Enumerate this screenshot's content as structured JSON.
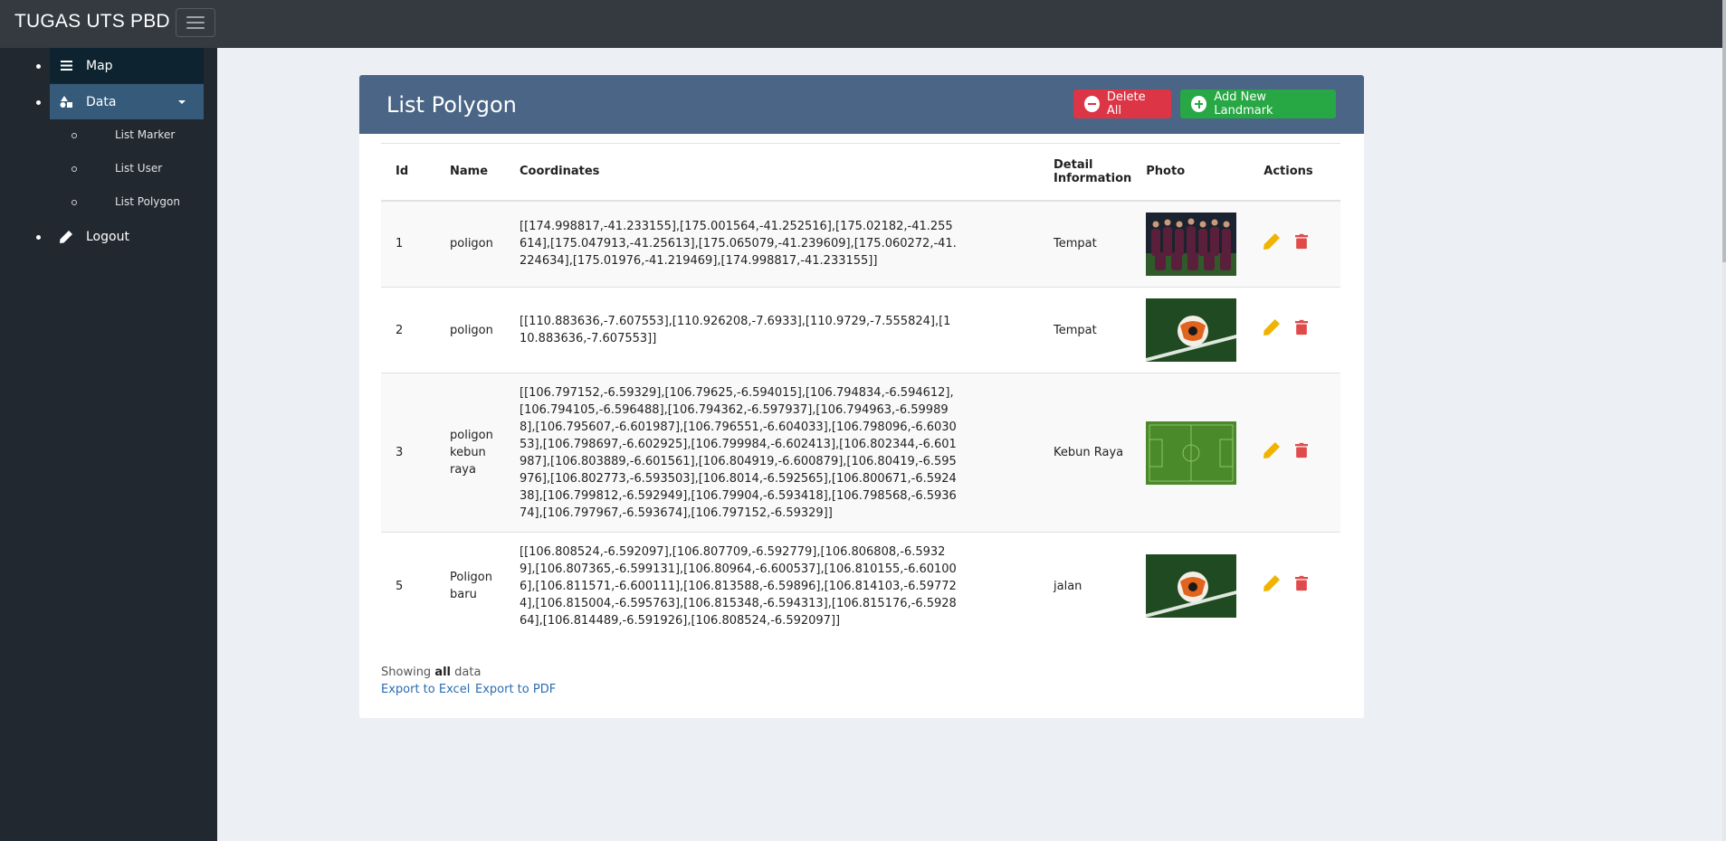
{
  "app": {
    "title": "TUGAS UTS PBD",
    "menu_toggle_icon": "hamburger-icon"
  },
  "sidebar": {
    "items": [
      {
        "label": "Map",
        "icon": "list-icon"
      },
      {
        "label": "Data",
        "icon": "shapes-icon"
      },
      {
        "label": "Logout",
        "icon": "pencil-icon"
      }
    ],
    "sub_items": [
      "List Marker",
      "List User",
      "List Polygon"
    ]
  },
  "panel": {
    "title": "List Polygon",
    "delete_all_label": "Delete All",
    "add_label": "Add New Landmark"
  },
  "table": {
    "headers": [
      "Id",
      "Name",
      "Coordinates",
      "Detail Information",
      "Photo",
      "Actions"
    ],
    "rows": [
      {
        "id": "1",
        "name": "poligon",
        "coordinates": "[[174.998817,-41.233155],[175.001564,-41.252516],[175.02182,-41.255614],[175.047913,-41.25613],[175.065079,-41.239609],[175.060272,-41.224634],[175.01976,-41.219469],[174.998817,-41.233155]]",
        "detail": "Tempat",
        "photo": "team-photo"
      },
      {
        "id": "2",
        "name": "poligon",
        "coordinates": "[[110.883636,-7.607553],[110.926208,-7.6933],[110.9729,-7.555824],[110.883636,-7.607553]]",
        "detail": "Tempat",
        "photo": "soccer-ball-photo"
      },
      {
        "id": "3",
        "name": "poligon kebun raya",
        "coordinates": "[[106.797152,-6.59329],[106.79625,-6.594015],[106.794834,-6.594612],[106.794105,-6.596488],[106.794362,-6.597937],[106.794963,-6.599898],[106.795607,-6.601987],[106.796551,-6.604033],[106.798096,-6.603053],[106.798697,-6.602925],[106.799984,-6.602413],[106.802344,-6.601987],[106.803889,-6.601561],[106.804919,-6.600879],[106.80419,-6.595976],[106.802773,-6.593503],[106.8014,-6.592565],[106.800671,-6.592438],[106.799812,-6.592949],[106.79904,-6.593418],[106.798568,-6.593674],[106.797967,-6.593674],[106.797152,-6.59329]]",
        "detail": "Kebun Raya",
        "photo": "soccer-field-photo"
      },
      {
        "id": "5",
        "name": "Poligon baru",
        "coordinates": "[[106.808524,-6.592097],[106.807709,-6.592779],[106.806808,-6.59329],[106.807365,-6.599131],[106.80964,-6.600537],[106.810155,-6.601006],[106.811571,-6.600111],[106.813588,-6.59896],[106.814103,-6.597724],[106.815004,-6.595763],[106.815348,-6.594313],[106.815176,-6.592864],[106.814489,-6.591926],[106.808524,-6.592097]]",
        "detail": "jalan",
        "photo": "soccer-ball-photo"
      }
    ]
  },
  "footer": {
    "showing_prefix": "Showing",
    "showing_bold": "all",
    "showing_suffix": "data",
    "export_excel": "Export to Excel",
    "export_pdf": "Export to PDF"
  },
  "colors": {
    "navbar": "#343a40",
    "sidebar": "#212830",
    "panel_header": "#4a6585",
    "danger": "#dc3545",
    "success": "#28a745",
    "edit_icon": "#f0b400",
    "delete_icon": "#e04a4a"
  }
}
